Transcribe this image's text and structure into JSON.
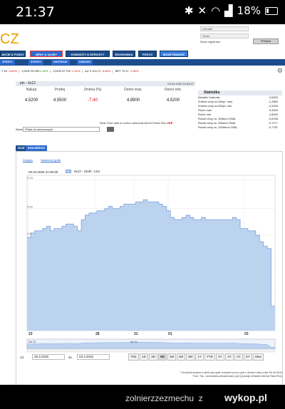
{
  "status_bar": {
    "time": "21:37",
    "battery": "18%"
  },
  "site": {
    "logo_text": "CZ",
    "login": {
      "user_label": "Uživatel",
      "pass_label": "Heslo",
      "register": "Nová registrace",
      "submit": "Přihlásit"
    }
  },
  "topnav": [
    "AKCIE & FONDY",
    "MĚNY & SAZBY",
    "KOMODITY & DERIVÁTY",
    "EKONOMIKA",
    "PRÁVO",
    "MOJE FINANCE"
  ],
  "subnav": [
    "ZPRÁVY",
    "STOPKY",
    "NÁSTROJE",
    "DISKUSE"
  ],
  "ticker": [
    {
      "text": "..7,59",
      "chg": "-3,81%",
      "dir": "neg"
    },
    {
      "text": "CZK/€ 25,099",
      "chg": "0,49%",
      "dir": "pos"
    },
    {
      "text": "CZK/$ 22,705",
      "chg": "-1,31%",
      "dir": "neg"
    },
    {
      "text": "AU 3 103,72",
      "chg": "-0,64%",
      "dir": "neg"
    },
    {
      "text": "BRT 79,37",
      "chg": "-1,50%",
      "dir": "neg"
    }
  ],
  "quote": {
    "title": "pin - 6x12",
    "date": "03.04.2025 15:59:47",
    "columns": [
      {
        "header": "Nákup",
        "value": "4,5200"
      },
      {
        "header": "Prodej",
        "value": "4,5500"
      },
      {
        "header": "Změna (%)",
        "value": "-7,40"
      },
      {
        "header": "Denní max.",
        "value": "4,8900"
      },
      {
        "header": "Denní min.",
        "value": "4,5200"
      }
    ],
    "rt_note": "Real-Time data si mohou aktivovat klienti Patria Plus",
    "rt_link": "ZDE",
    "akcie_label": "Akcie",
    "akcie_select": "Přidat do sledovaných",
    "akcie_button": "OK"
  },
  "stats": {
    "title": "Statistika",
    "rows": [
      {
        "label": "Aktuální hodnota",
        "value": "4,5200"
      },
      {
        "label": "Změna ceny od 52týd. max",
        "value": "-1,2850"
      },
      {
        "label": "Změna ceny od 52týd. min",
        "value": "-2,0000"
      },
      {
        "label": "Roční max",
        "value": "5,4000"
      },
      {
        "label": "Roční min",
        "value": "4,8000"
      },
      {
        "label": "Rozdíl ceny vs. 30denní SMA",
        "value": "-0,6196"
      },
      {
        "label": "Rozdíl ceny vs. 60denní SMA",
        "value": "-0,7177"
      },
      {
        "label": "Rozdíl ceny vs. 200denní SMA",
        "value": "-0,7787"
      }
    ]
  },
  "chart_tabs": [
    "Graf",
    "Interaktivní graf"
  ],
  "chart_links": [
    "Analýzy",
    "Nastavení grafu"
  ],
  "chart_legend": {
    "date": "03.04.2025 21:00:00",
    "series_label": "6x12 - závěr: 4,54"
  },
  "chart_data": {
    "type": "area",
    "x_labels": [
      "23",
      "28",
      "31",
      "01",
      "03"
    ],
    "y_ticks": [
      "5,13",
      "5,00",
      "4,88",
      "4,75",
      "4,63",
      "4,50"
    ],
    "ylim": [
      4.45,
      5.15
    ],
    "values": [
      4.87,
      4.89,
      4.9,
      4.9,
      4.91,
      4.92,
      4.9,
      4.91,
      4.91,
      4.92,
      4.93,
      4.93,
      4.92,
      4.9,
      4.95,
      4.97,
      4.98,
      4.98,
      4.99,
      4.99,
      5.0,
      5.01,
      5.0,
      5.0,
      5.01,
      5.02,
      5.02,
      5.02,
      5.03,
      5.03,
      5.04,
      5.03,
      5.03,
      5.03,
      5.02,
      5.01,
      4.99,
      4.96,
      4.95,
      4.95,
      4.96,
      4.97,
      4.96,
      4.95,
      4.95,
      4.96,
      4.95,
      4.95,
      4.95,
      4.95,
      4.95,
      4.95,
      4.95,
      4.96,
      4.95,
      4.91,
      4.91,
      4.9,
      4.9,
      4.88,
      4.85,
      4.83,
      4.82,
      4.56,
      4.56
    ],
    "navigator_labels": [
      "bře 23",
      "bře 31"
    ]
  },
  "range_selector": {
    "from_label": "od",
    "from_value": "26.3.2025",
    "to_label": "do",
    "to_value": "03.4.2025",
    "buttons": [
      "Tick",
      "1D",
      "3D",
      "5D",
      "1M",
      "2M",
      "3M",
      "1Y",
      "YTD",
      "2Y",
      "3Y",
      "4Y",
      "5Y",
      "Max"
    ],
    "active": "5D"
  },
  "footnotes": [
    "* Technická analýza a výběr typu grafu dostupné jen pro graf s denními daty (volba 1M až MAX)",
    "Pozn. Tick - Automaticky aktualizovaný graf (vyžaduje přihlášení klienta Patria Plus)"
  ],
  "watermark": {
    "user": "zolnierzzezmechu",
    "sep": "z",
    "site": "wykop.pl"
  }
}
